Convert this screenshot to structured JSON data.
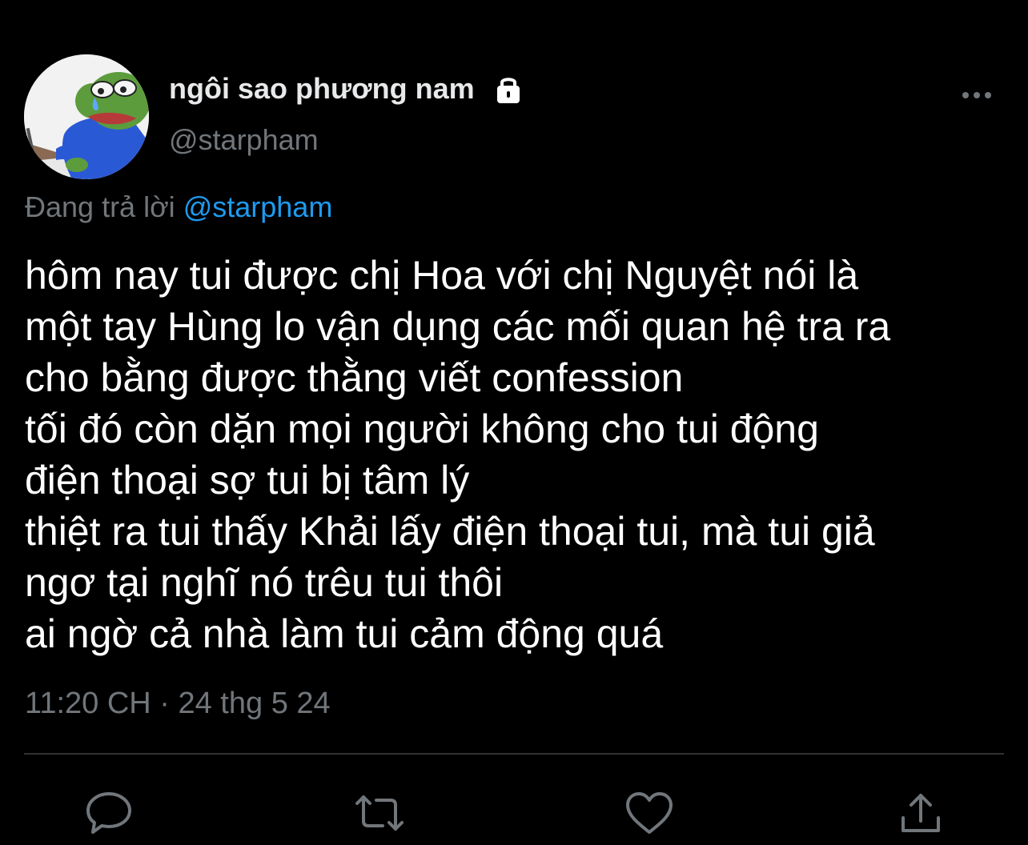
{
  "author": {
    "display_name": "ngôi sao phương nam",
    "handle": "@starpham",
    "protected_icon": "lock-icon",
    "avatar_icon": "avatar"
  },
  "reply": {
    "prefix": "Đang trả lời",
    "mention": "@starpham"
  },
  "tweet": {
    "lines": [
      "hôm nay tui được chị Hoa với chị Nguyệt nói là",
      "một tay Hùng lo vận dụng các mối quan hệ tra ra",
      "cho bằng được thằng viết confession",
      "tối đó còn dặn mọi người không cho tui động",
      "điện thoại sợ tui bị tâm lý",
      "thiệt ra tui thấy Khải lấy điện thoại tui, mà tui giả",
      "ngơ tại nghĩ nó trêu tui thôi",
      "ai ngờ cả nhà làm tui cảm động quá"
    ],
    "timestamp": "11:20 CH · 24 thg 5 24"
  },
  "actions": [
    "reply-icon",
    "retweet-icon",
    "like-icon",
    "share-icon"
  ],
  "more_icon": "more-icon",
  "colors": {
    "background": "#000000",
    "text": "#ffffff",
    "secondary": "#71767b",
    "accent": "#1d9bf0",
    "divider": "#2f3336"
  }
}
